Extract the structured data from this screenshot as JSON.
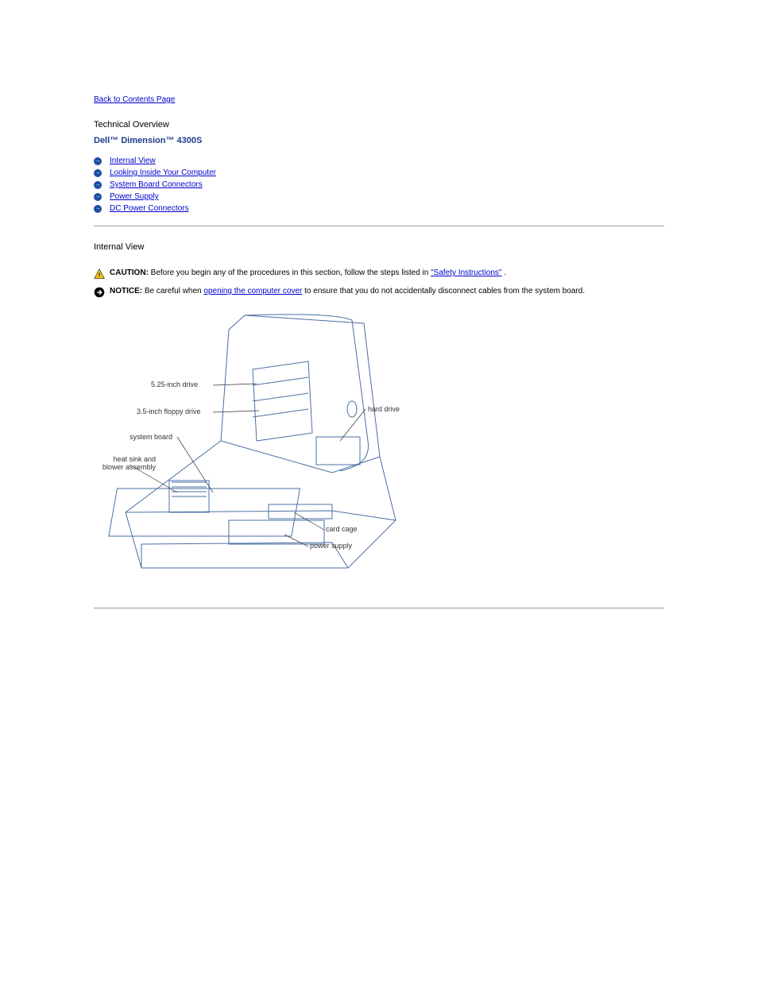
{
  "back_link": "Back to Contents Page",
  "title": "Technical Overview",
  "subtitle": "Dell™ Dimension™ 4300S",
  "toc": [
    "Internal View",
    "Looking Inside Your Computer",
    "System Board Connectors",
    "Power Supply",
    "DC Power Connectors"
  ],
  "section_title": "Internal View",
  "caution": {
    "label": "CAUTION:",
    "text_before": "Before you begin any of the procedures in this section, follow the steps listed in ",
    "link": "\"Safety Instructions\"",
    "text_after": "."
  },
  "notice": {
    "label": "NOTICE:",
    "text_before": "Be careful when ",
    "link": "opening the computer cover",
    "text_after": " to ensure that you do not accidentally disconnect cables from the system board."
  },
  "diagram_labels": {
    "drive_525": "5.25-inch drive",
    "floppy": "3.5-inch floppy drive",
    "system_board": "system board",
    "heat_sink": "heat sink and blower assembly",
    "hard_drive": "hard drive",
    "card_cage": "card cage",
    "power_supply": "power supply"
  }
}
